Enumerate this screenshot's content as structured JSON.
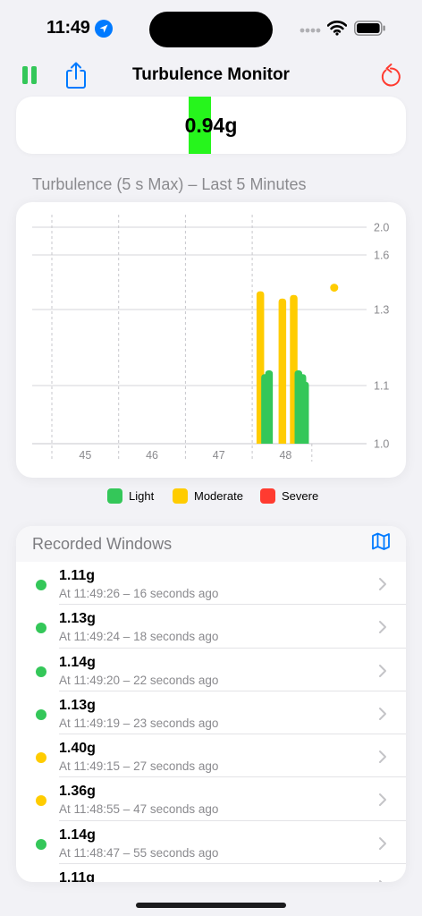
{
  "status_bar": {
    "time": "11:49"
  },
  "nav": {
    "title": "Turbulence Monitor"
  },
  "reading": {
    "value": "0.94g",
    "level_color": "#26f51c"
  },
  "chart_heading": "Turbulence (5 s Max) – Last 5 Minutes",
  "chart_data": {
    "type": "bar",
    "title": "Turbulence (5 s Max) – Last 5 Minutes",
    "xlabel": "",
    "ylabel": "",
    "x_tick_labels": [
      "45",
      "46",
      "47",
      "48"
    ],
    "y_tick_labels": [
      "1.0",
      "1.1",
      "1.3",
      "1.6",
      "2.0"
    ],
    "ylim": [
      1.0,
      2.0
    ],
    "grid": true,
    "legend_placement": "bottom",
    "bars": [
      {
        "x": 48.05,
        "value": 1.4,
        "level": "moderate"
      },
      {
        "x": 48.12,
        "value": 1.13,
        "level": "light"
      },
      {
        "x": 48.18,
        "value": 1.14,
        "level": "light"
      },
      {
        "x": 48.38,
        "value": 1.36,
        "level": "moderate"
      },
      {
        "x": 48.55,
        "value": 1.38,
        "level": "moderate"
      },
      {
        "x": 48.62,
        "value": 1.14,
        "level": "light"
      },
      {
        "x": 48.68,
        "value": 1.13,
        "level": "light"
      },
      {
        "x": 48.72,
        "value": 1.11,
        "level": "light"
      }
    ],
    "point": {
      "x": 49.0,
      "value": 1.42,
      "level": "moderate"
    }
  },
  "legend": [
    {
      "label": "Light",
      "color": "#34c759"
    },
    {
      "label": "Moderate",
      "color": "#ffcc00"
    },
    {
      "label": "Severe",
      "color": "#ff3b30"
    }
  ],
  "colors": {
    "light": "#34c759",
    "moderate": "#ffcc00",
    "severe": "#ff3b30",
    "accent": "#007aff"
  },
  "windows": {
    "title": "Recorded Windows",
    "rows": [
      {
        "value": "1.11g",
        "time": "At 11:49:26 – 16 seconds ago",
        "level": "light"
      },
      {
        "value": "1.13g",
        "time": "At 11:49:24 – 18 seconds ago",
        "level": "light"
      },
      {
        "value": "1.14g",
        "time": "At 11:49:20 – 22 seconds ago",
        "level": "light"
      },
      {
        "value": "1.13g",
        "time": "At 11:49:19 – 23 seconds ago",
        "level": "light"
      },
      {
        "value": "1.40g",
        "time": "At 11:49:15 – 27 seconds ago",
        "level": "moderate"
      },
      {
        "value": "1.36g",
        "time": "At 11:48:55 – 47 seconds ago",
        "level": "moderate"
      },
      {
        "value": "1.14g",
        "time": "At 11:48:47 – 55 seconds ago",
        "level": "light"
      },
      {
        "value": "1.11g",
        "time": "",
        "level": "light"
      }
    ]
  }
}
